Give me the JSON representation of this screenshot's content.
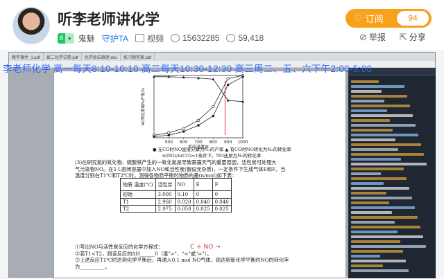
{
  "header": {
    "title": "听李老师讲化学",
    "level_badge": "8",
    "level_name": "鬼魅",
    "guard_link": "守护TA",
    "video_label": "视频",
    "id_number": "15632285",
    "fans_count": "59,418"
  },
  "subscribe": {
    "label": "订阅",
    "count": "94"
  },
  "actions": {
    "report": "举报",
    "share": "分享"
  },
  "stream": {
    "overlay_text": "李老师化学 高一每天8:10-10:10 高二每天10:30-12:30 高三周二、五、六下午2:00-5:00",
    "tabs": [
      "教学课件_1.pdf",
      "高二化学试卷.pdf",
      "化学反应原理.doc",
      "练习题答案.pdf"
    ]
  },
  "document": {
    "chart_legend_1": "● 无CO时NO直接分解为N₂的产率 ▲ 有CO时NO转化为N₂的转化率",
    "chart_legend_2": "n(NO)/n(CO)=1条件下，NO还原为N₂的转化率",
    "paragraph": [
      "(3)在研究氮的氧化物、硫酸铁产生的一氧化氮是导致雾霾天气的重要原因，活性炭可处理大",
      "气污染物NO。在5 L密闭容器中加入NO和活性炭(假设无杂质)，一定条件下生成气体E和F。当",
      "温度分别在T1℃和T2℃时，测得各物质平衡时物质的量(n/mol)如下表："
    ],
    "table": {
      "header": [
        "物质 温度(℃)",
        "活性炭",
        "NO",
        "E",
        "F"
      ],
      "rows": [
        [
          "初始",
          "3.000",
          "0.10",
          "0",
          "0"
        ],
        [
          "T1",
          "2.960",
          "0.020",
          "0.040",
          "0.040"
        ],
        [
          "T2",
          "2.975",
          "0.050",
          "0.025",
          "0.025"
        ]
      ]
    },
    "questions": [
      "①写出NO与活性炭反应的化学方程式：",
      "②若T1<T2，则该反应的ΔH______0（填\">\"、\"<\"或\"=\"）。",
      "③上述反应T1℃时达到化学平衡后，再通入0.1 mol NO气体，则达到新化学平衡时NO的转化率",
      "为__________。"
    ],
    "handwriting": "C + NO →"
  },
  "chart_data": {
    "type": "line",
    "title": "",
    "xlabel": "反应温度/K",
    "ylabel": "NO转化率或N₂产率/%",
    "x": [
      400,
      500,
      600,
      700,
      800,
      900,
      1000
    ],
    "xticks": [
      "500",
      "600",
      "700",
      "800",
      "900",
      "1000"
    ],
    "ylim": [
      0,
      100
    ],
    "series": [
      {
        "marker": "triangle",
        "values": [
          98,
          98,
          97,
          96,
          94,
          60,
          58
        ]
      },
      {
        "marker": "circle",
        "values": [
          4,
          8,
          15,
          28,
          50,
          95,
          100
        ]
      },
      {
        "marker": "square",
        "values": [
          2,
          4,
          10,
          20,
          35,
          85,
          98
        ]
      }
    ]
  }
}
